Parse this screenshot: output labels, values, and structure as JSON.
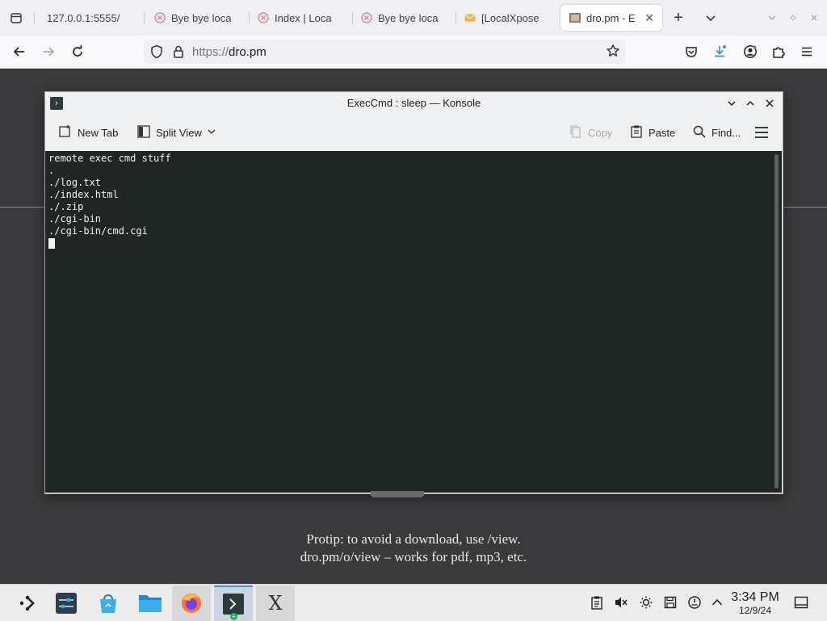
{
  "browser": {
    "tabs": [
      {
        "label": "127.0.0.1:5555/",
        "icon": "none"
      },
      {
        "label": "Bye bye loca",
        "icon": "localxpose-icon"
      },
      {
        "label": "Index | Loca",
        "icon": "localxpose-icon"
      },
      {
        "label": "Bye bye loca",
        "icon": "localxpose-icon"
      },
      {
        "label": "[LocalXpose",
        "icon": "mail-icon"
      },
      {
        "label": "dro.pm - E",
        "icon": "page-icon"
      }
    ],
    "url_protocol": "https://",
    "url_host": "dro.pm"
  },
  "page": {
    "protip_line1": "Protip: to avoid a download, use /view.",
    "protip_line2": "dro.pm/o/view – works for pdf, mp3, etc."
  },
  "konsole": {
    "title": "ExecCmd : sleep — Konsole",
    "toolbar": {
      "new_tab": "New Tab",
      "split_view": "Split View",
      "copy": "Copy",
      "paste": "Paste",
      "find": "Find..."
    },
    "terminal_lines": [
      "remote exec cmd stuff",
      ".",
      "./log.txt",
      "./index.html",
      "./.zip",
      "./cgi-bin",
      "./cgi-bin/cmd.cgi"
    ]
  },
  "taskbar": {
    "time": "3:34 PM",
    "date": "12/9/24"
  },
  "colors": {
    "terminal_bg": "#1f2624",
    "page_bg": "#3a3a3c",
    "accent": "#4c8fd0"
  }
}
